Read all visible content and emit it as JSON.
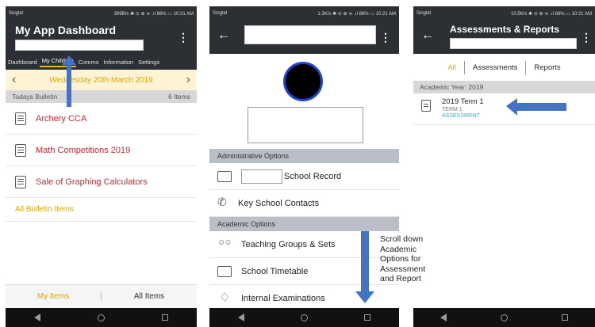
{
  "phone1": {
    "status": {
      "carrier": "Singtel",
      "info": "399B/s ✱ ⊙ ⊕ ᯤ .ıl 86% ▭ 10:21 AM"
    },
    "app_title": "My App Dashboard",
    "tabs": [
      "Dashboard",
      "My Children",
      "Comms",
      "Information",
      "Settings"
    ],
    "date": "Wednesday 20th March 2019",
    "bulletin_heading": "Todays Bulletin",
    "bulletin_count": "6 Items",
    "bulletin_items": [
      "Archery CCA",
      "Math Competitions 2019",
      "Sale of Graphing Calculators"
    ],
    "all_bulletin": "All Bulletin Items",
    "bottom_tabs": {
      "my_items": "My Items",
      "all_items": "All Items"
    }
  },
  "phone2": {
    "status": {
      "carrier": "Singtel",
      "info": "1.3K/s ✱ ⊙ ⊕ ᯤ .ıl 86% ▭ 10:21 AM"
    },
    "admin_heading": "Administrative Options",
    "admin_items": [
      "School Record",
      "Key School Contacts"
    ],
    "academic_heading": "Academic Options",
    "academic_items": [
      "Teaching Groups & Sets",
      "School Timetable",
      "Internal Examinations"
    ]
  },
  "phone3": {
    "status": {
      "carrier": "Singtel",
      "info": "10.5K/s ✱ ⊙ ⊕ ᯤ .ıl 86% ▭ 10:21 AM"
    },
    "title": "Assessments & Reports",
    "segments": [
      "All",
      "Assessments",
      "Reports"
    ],
    "year_heading": "Academic Year: 2019",
    "item": {
      "title": "2019 Term 1",
      "sub": "TERM 1",
      "type": "ASSESSMENT"
    }
  },
  "annotation": {
    "lines": [
      "Scroll down",
      "Academic",
      "Options for",
      "Assessment",
      "and Report"
    ]
  },
  "colors": {
    "accent_yellow": "#e0a800",
    "bulletin_red": "#c6282f",
    "arrow_blue": "#4472c4",
    "appbar": "#2c2f33"
  }
}
